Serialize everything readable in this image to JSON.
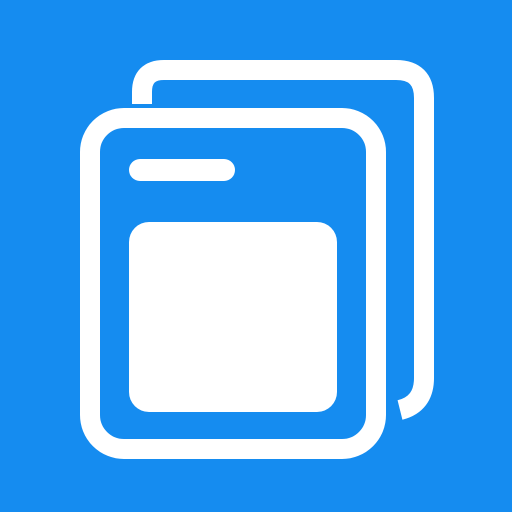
{
  "icon": {
    "name": "windows-stack-icon",
    "description_name": "stacked-windows-icon",
    "colors": {
      "background": "#158cf0",
      "foreground": "#ffffff"
    }
  }
}
